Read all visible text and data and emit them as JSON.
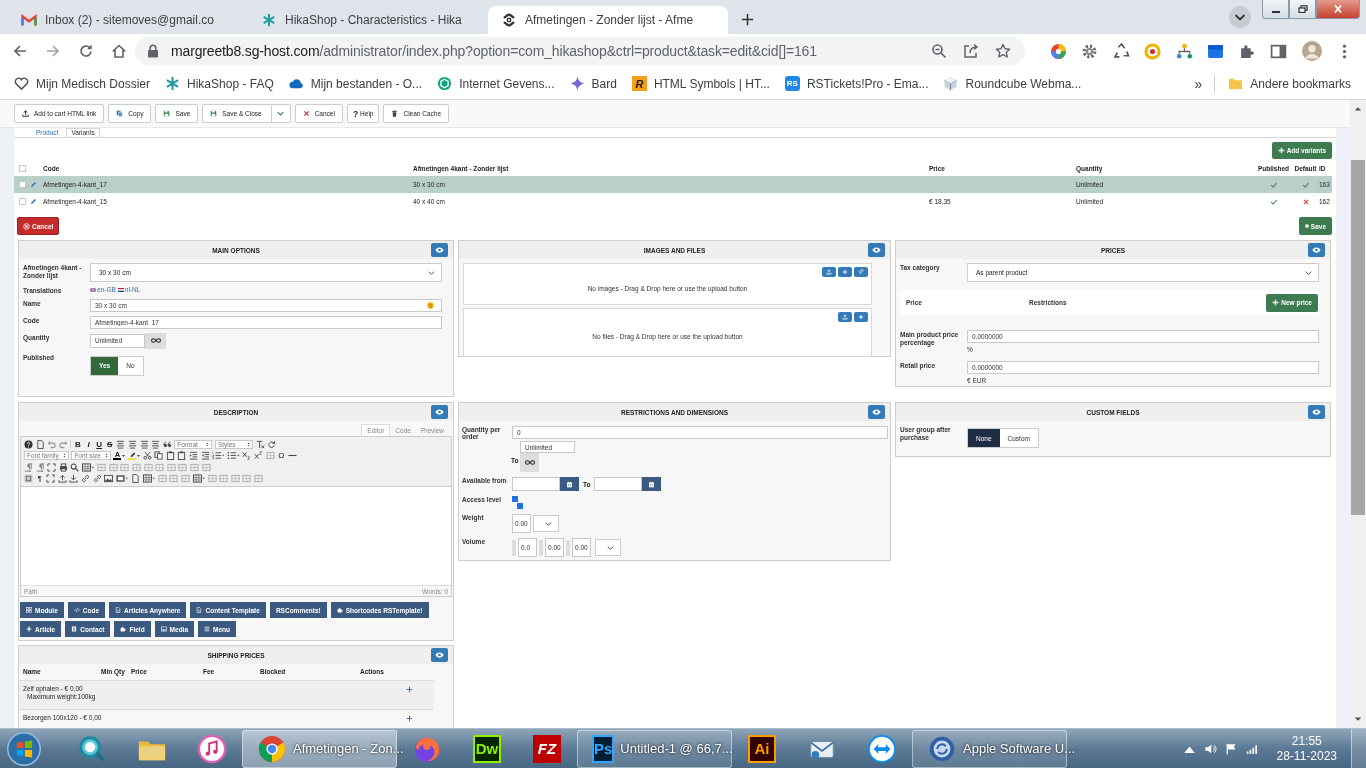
{
  "browser": {
    "tabs": [
      {
        "title": "Inbox (2) - sitemoves@gmail.co",
        "kind": "gmail",
        "selected": false
      },
      {
        "title": "HikaShop - Characteristics - Hika",
        "kind": "hikashop",
        "selected": false
      },
      {
        "title": "Afmetingen - Zonder lijst - Afme",
        "kind": "joomla",
        "selected": true
      }
    ],
    "url": {
      "host": "margreetb8.sg-host.com",
      "path": "/administrator/index.php?option=com_hikashop&ctrl=product&task=edit&cid[]=161"
    },
    "bookmarks": [
      {
        "label": "Mijn Medisch Dossier",
        "kind": "dossier"
      },
      {
        "label": "HikaShop - FAQ",
        "kind": "hikashop"
      },
      {
        "label": "Mijn bestanden - O...",
        "kind": "cloud"
      },
      {
        "label": "Internet Gevens...",
        "kind": "knot"
      },
      {
        "label": "Bard",
        "kind": "sparkle"
      },
      {
        "label": "HTML Symbols | HT...",
        "kind": "letter",
        "mark": "R"
      },
      {
        "label": "RSTickets!Pro - Ema...",
        "kind": "letter",
        "mark": "RS"
      },
      {
        "label": "Roundcube Webma...",
        "kind": "cube"
      }
    ],
    "more": "»",
    "other": "Andere bookmarks"
  },
  "toolbar": [
    {
      "label": "Add to cart HTML link",
      "kind": "upload"
    },
    {
      "label": "Copy",
      "kind": "copy"
    },
    {
      "label": "Save",
      "kind": "save"
    },
    {
      "label": "Save & Close",
      "kind": "save-menu"
    },
    {
      "label": "Cancel",
      "kind": "cancel"
    },
    {
      "label": "Help",
      "kind": "help",
      "glyph": "?"
    },
    {
      "label": "Clean Cache",
      "kind": "trash"
    }
  ],
  "product_tabs": [
    {
      "label": "Product",
      "selected": false
    },
    {
      "label": "Variants",
      "selected": true
    }
  ],
  "variants": {
    "add": "Add variants",
    "select_all": {
      "checked": false
    },
    "columns": [
      "Code",
      "Afmetingen 4kant - Zonder lijst",
      "Price",
      "Quantity",
      "Published",
      "Default",
      "ID"
    ],
    "rows": [
      {
        "code": "Afmetingen-4-kant_17",
        "size": "30 x 30 cm",
        "quantity": "Unlimited",
        "published": true,
        "default": true,
        "id": "163",
        "checked": false,
        "selected": true
      },
      {
        "code": "Afmetingen-4-kant_15",
        "size": "40 x 40 cm",
        "price": "€ 18,35",
        "quantity": "Unlimited",
        "published": true,
        "default": false,
        "id": "162",
        "checked": false,
        "selected": false
      }
    ]
  },
  "actions": {
    "cancel": "Cancel",
    "save": "Save"
  },
  "main_options": {
    "title": "MAIN OPTIONS",
    "characteristic": {
      "label": "Afmetingen 4kant - Zonder lijst",
      "value": "30 x 30 cm"
    },
    "translations": {
      "label": "Translations",
      "languages": [
        {
          "code": "en-GB",
          "kind": "uk"
        },
        {
          "code": "nl-NL",
          "kind": "nl"
        }
      ]
    },
    "name": {
      "label": "Name",
      "value": "30 x 30 cm"
    },
    "code": {
      "label": "Code",
      "value": "Afmetingen-4-kant_17"
    },
    "quantity": {
      "label": "Quantity",
      "value": "Unlimited"
    },
    "published": {
      "label": "Published",
      "options": [
        {
          "label": "Yes",
          "selected": true
        },
        {
          "label": "No",
          "selected": false
        }
      ]
    }
  },
  "images": {
    "title": "IMAGES AND FILES",
    "zones": [
      {
        "text": "No images - Drag & Drop here or use the upload button",
        "buttons": [
          {
            "kind": "upload"
          },
          {
            "kind": "add"
          },
          {
            "kind": "link"
          }
        ]
      },
      {
        "text": "No files - Drag & Drop here or use the upload button",
        "buttons": [
          {
            "kind": "upload"
          },
          {
            "kind": "add"
          }
        ]
      }
    ]
  },
  "prices": {
    "title": "PRICES",
    "tax": {
      "label": "Tax category",
      "value": "As parent product"
    },
    "columns": [
      "Price",
      "Restrictions"
    ],
    "new_price": "New price",
    "percentage": {
      "label": "Main product price percentage",
      "value": "0.0000000",
      "unit": "%"
    },
    "retail": {
      "label": "Retail price",
      "value": "0.0000000",
      "unit": "€ EUR"
    }
  },
  "description": {
    "title": "DESCRIPTION",
    "editor_tabs": [
      {
        "label": "Editor",
        "selected": true
      },
      {
        "label": "Code",
        "selected": false
      },
      {
        "label": "Preview",
        "selected": false
      }
    ],
    "toolbar": [
      [
        {
          "kind": "help"
        },
        {
          "kind": "doc"
        },
        {
          "kind": "undo"
        },
        {
          "kind": "redo"
        },
        {
          "kind": "sep"
        },
        {
          "kind": "bold",
          "text": "B"
        },
        {
          "kind": "italic",
          "text": "I"
        },
        {
          "kind": "underline",
          "text": "U"
        },
        {
          "kind": "strike",
          "text": "S"
        },
        {
          "kind": "align"
        },
        {
          "kind": "align"
        },
        {
          "kind": "align"
        },
        {
          "kind": "align"
        },
        {
          "kind": "quote"
        },
        {
          "kind": "dropdown",
          "text": "Format"
        },
        {
          "kind": "dropdown",
          "text": "Styles"
        },
        {
          "kind": "clear"
        },
        {
          "kind": "reset"
        }
      ],
      [
        {
          "kind": "dropdown",
          "text": "Font family"
        },
        {
          "kind": "dropdown",
          "text": "Font size"
        },
        {
          "kind": "color",
          "text": "A",
          "color": "#000000"
        },
        {
          "kind": "highlight",
          "color": "#f2e33a"
        },
        {
          "kind": "cut"
        },
        {
          "kind": "copy"
        },
        {
          "kind": "paste"
        },
        {
          "kind": "paste"
        },
        {
          "kind": "indent"
        },
        {
          "kind": "outdent"
        },
        {
          "kind": "olist"
        },
        {
          "kind": "ulist"
        },
        {
          "kind": "sub"
        },
        {
          "kind": "sup"
        },
        {
          "kind": "cell"
        },
        {
          "kind": "char",
          "text": "Ω"
        },
        {
          "kind": "hr"
        }
      ],
      [
        {
          "kind": "ltr"
        },
        {
          "kind": "ltr"
        },
        {
          "kind": "fullscreen"
        },
        {
          "kind": "print"
        },
        {
          "kind": "search"
        },
        {
          "kind": "table"
        },
        {
          "kind": "cell"
        },
        {
          "kind": "cell"
        },
        {
          "kind": "cell"
        },
        {
          "kind": "cell"
        },
        {
          "kind": "cell"
        },
        {
          "kind": "cell"
        },
        {
          "kind": "cell"
        },
        {
          "kind": "cell"
        },
        {
          "kind": "cell"
        },
        {
          "kind": "cell"
        }
      ],
      [
        {
          "kind": "template"
        },
        {
          "kind": "char",
          "text": "¶"
        },
        {
          "kind": "fullscreen"
        },
        {
          "kind": "upload"
        },
        {
          "kind": "download"
        },
        {
          "kind": "link"
        },
        {
          "kind": "link"
        },
        {
          "kind": "image"
        },
        {
          "kind": "media"
        },
        {
          "kind": "doc"
        },
        {
          "kind": "table"
        },
        {
          "kind": "cell"
        },
        {
          "kind": "cell"
        },
        {
          "kind": "cell"
        },
        {
          "kind": "table"
        },
        {
          "kind": "cell"
        },
        {
          "kind": "cell"
        },
        {
          "kind": "cell"
        },
        {
          "kind": "cell"
        },
        {
          "kind": "cell"
        }
      ]
    ],
    "path": "Path",
    "words": "Words: 0",
    "buttons": [
      [
        {
          "label": "Module",
          "kind": "module"
        },
        {
          "label": "Code",
          "kind": "code"
        },
        {
          "label": "Articles Anywhere",
          "kind": "file"
        },
        {
          "label": "Content Template",
          "kind": "file"
        },
        {
          "label": "RSComments!",
          "kind": "plain"
        },
        {
          "label": "Shortcodes RSTemplate!",
          "kind": "puzzle"
        }
      ],
      [
        {
          "label": "Article",
          "kind": "plus"
        },
        {
          "label": "Contact",
          "kind": "card"
        },
        {
          "label": "Field",
          "kind": "puzzle"
        },
        {
          "label": "Media",
          "kind": "picture"
        },
        {
          "label": "Menu",
          "kind": "bars"
        }
      ]
    ]
  },
  "restrictions": {
    "title": "RESTRICTIONS AND DIMENSIONS",
    "quantity": {
      "label": "Quantity per order",
      "min": "0",
      "max": "Unlimited",
      "to": "To"
    },
    "available": {
      "label": "Available from",
      "to": "To"
    },
    "access": {
      "label": "Access level",
      "items": [
        {
          "checked": true
        },
        {
          "checked": true
        }
      ]
    },
    "weight": {
      "label": "Weight",
      "value": "0.00"
    },
    "volume": {
      "label": "Volume",
      "values": [
        "0.0",
        "0.00",
        "0.00"
      ]
    }
  },
  "custom_fields": {
    "title": "CUSTOM FIELDS",
    "user_group": {
      "label": "User group after purchase",
      "options": [
        {
          "label": "None",
          "selected": true
        },
        {
          "label": "Custom",
          "selected": false
        }
      ]
    }
  },
  "shipping": {
    "title": "SHIPPING PRICES",
    "columns": [
      "Name",
      "Min Qty",
      "Price",
      "Fee",
      "Blocked",
      "Actions"
    ],
    "rows": [
      {
        "name": "Zelf ophalen - € 0,00",
        "note": "Maximum weight:100kg"
      },
      {
        "name": "Bezorgen 100x120 - € 0,00"
      }
    ]
  },
  "taskbar": {
    "apps": [
      {
        "kind": "search",
        "selected": false
      },
      {
        "kind": "folder",
        "selected": false
      },
      {
        "kind": "music",
        "selected": false
      },
      {
        "kind": "chrome",
        "label": "Afmetingen - Zon...",
        "selected": true
      },
      {
        "kind": "firefox",
        "selected": false
      },
      {
        "kind": "tile",
        "mark": "Dw",
        "selected": false
      },
      {
        "kind": "tile",
        "mark": "FZ",
        "selected": false
      },
      {
        "kind": "tile",
        "mark": "Ps",
        "label": "Untitled-1 @ 66,7...",
        "selected": false
      },
      {
        "kind": "tile",
        "mark": "Ai",
        "selected": false
      },
      {
        "kind": "mail",
        "selected": false
      },
      {
        "kind": "arrows",
        "selected": false
      },
      {
        "kind": "update",
        "label": "Apple Software U...",
        "selected": false
      }
    ],
    "time": "21:55",
    "date": "28-11-2023"
  }
}
